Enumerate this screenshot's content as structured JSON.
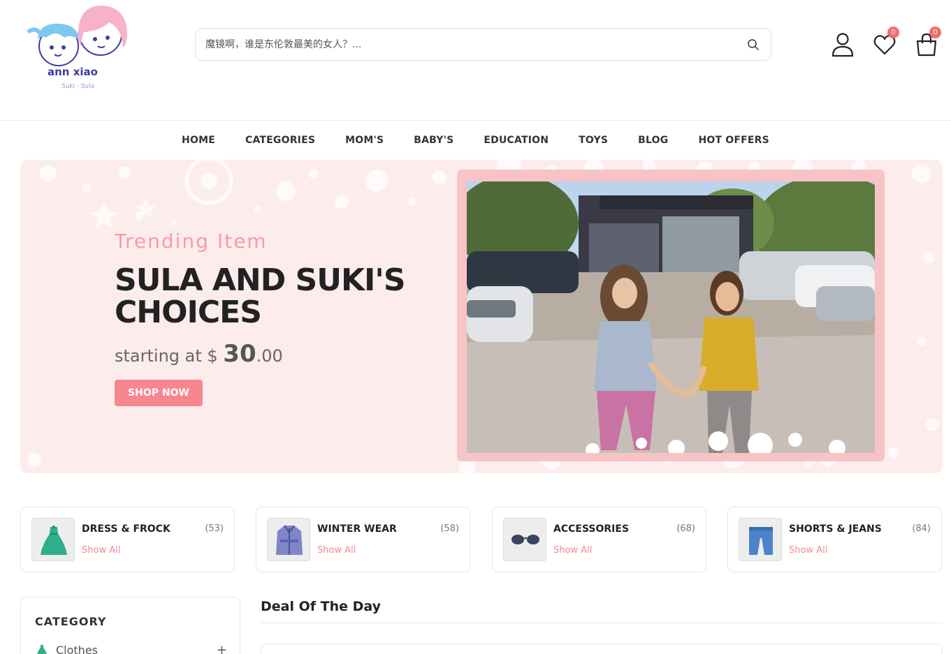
{
  "logo": {
    "text": "ann xiao",
    "sub": "Suki · Sula"
  },
  "search": {
    "placeholder": "魔镜啊，谁是东伦敦最美的女人？..."
  },
  "header_icons": {
    "wishlist_count": "0",
    "cart_count": "0"
  },
  "nav": [
    "HOME",
    "CATEGORIES",
    "MOM'S",
    "BABY'S",
    "EDUCATION",
    "TOYS",
    "BLOG",
    "HOT OFFERS"
  ],
  "banner": {
    "subtitle": "Trending Item",
    "title": "SULA AND SUKI'S CHOICES",
    "price_prefix": "starting at $ ",
    "price_main": "30",
    "price_cents": ".00",
    "button": "SHOP NOW"
  },
  "categories": [
    {
      "title": "DRESS & FROCK",
      "count": "(53)",
      "link": "Show All",
      "icon": "dress-icon"
    },
    {
      "title": "WINTER WEAR",
      "count": "(58)",
      "link": "Show All",
      "icon": "coat-icon"
    },
    {
      "title": "ACCESSORIES",
      "count": "(68)",
      "link": "Show All",
      "icon": "glasses-icon"
    },
    {
      "title": "SHORTS & JEANS",
      "count": "(84)",
      "link": "Show All",
      "icon": "shorts-icon"
    }
  ],
  "sidebar": {
    "heading": "CATEGORY",
    "items": [
      {
        "label": "Clothes",
        "toggle": "+"
      }
    ]
  },
  "deal": {
    "title": "Deal Of The Day"
  },
  "colors": {
    "accent": "#f8868f",
    "banner_bg": "#fdecec",
    "badge": "#f36c6c"
  }
}
